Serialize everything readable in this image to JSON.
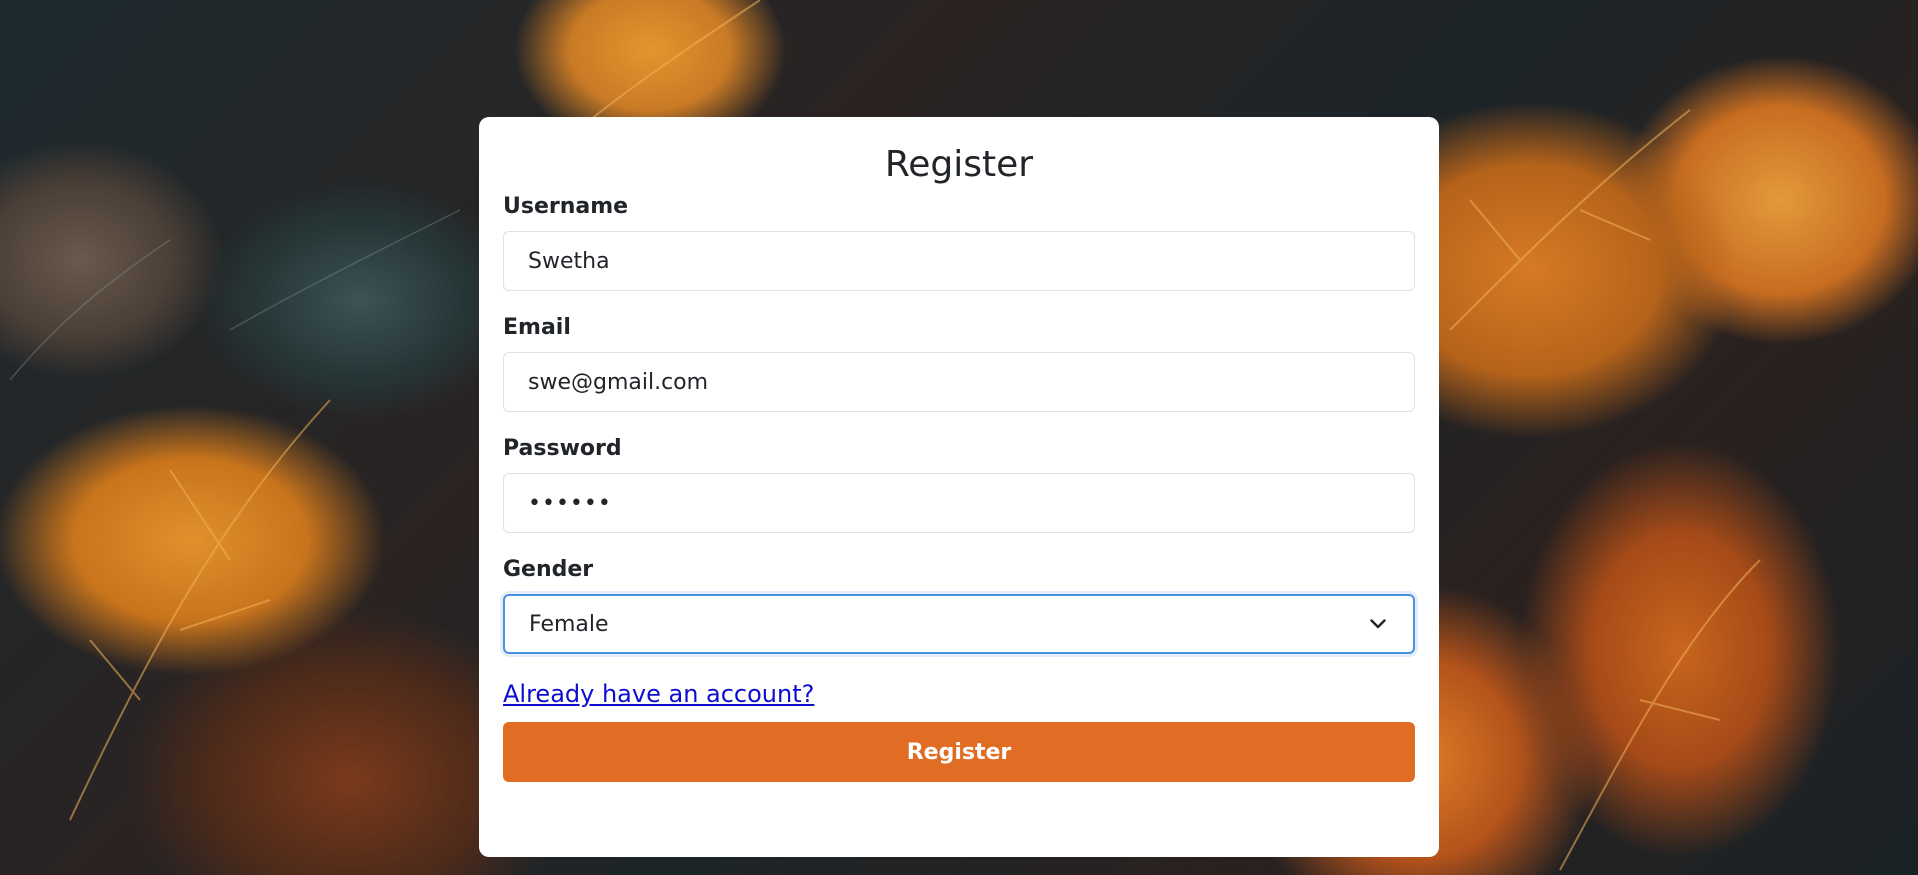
{
  "form": {
    "title": "Register",
    "username": {
      "label": "Username",
      "value": "Swetha"
    },
    "email": {
      "label": "Email",
      "value": "swe@gmail.com"
    },
    "password": {
      "label": "Password",
      "value": "••••••"
    },
    "gender": {
      "label": "Gender",
      "selected": "Female"
    },
    "login_link": "Already have an account?",
    "submit_label": "Register"
  },
  "colors": {
    "accent": "#e06d23",
    "focus_border": "#4a90e2",
    "link": "#0d0dcf"
  },
  "icons": {
    "select_indicator": "chevron-down-icon",
    "background": "autumn-leaves-background"
  }
}
